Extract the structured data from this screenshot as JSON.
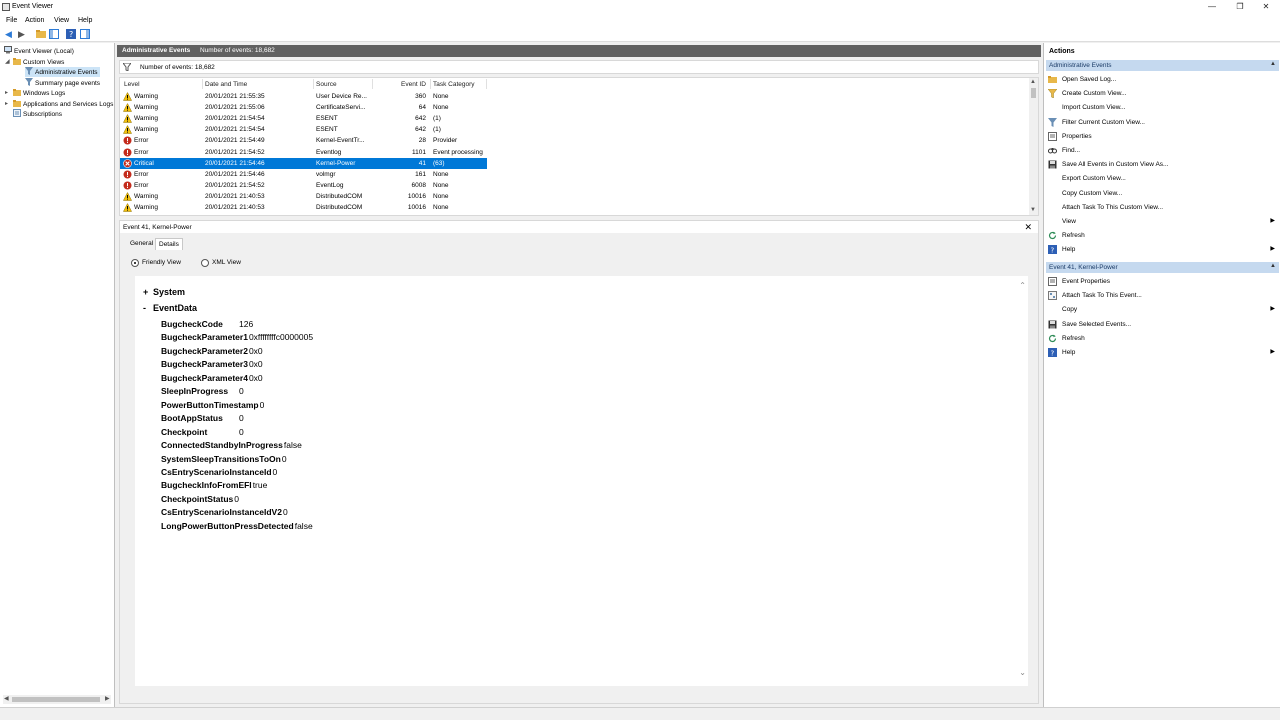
{
  "window": {
    "title": "Event Viewer",
    "controls": {
      "minimize": "—",
      "restore": "❐",
      "close": "✕"
    }
  },
  "menu": [
    "File",
    "Action",
    "View",
    "Help"
  ],
  "tree": {
    "items": [
      {
        "label": "Event Viewer (Local)"
      },
      {
        "label": "Custom Views"
      },
      {
        "label": "Administrative Events"
      },
      {
        "label": "Summary page events"
      },
      {
        "label": "Windows Logs"
      },
      {
        "label": "Applications and Services Logs"
      },
      {
        "label": "Subscriptions"
      }
    ]
  },
  "center": {
    "header_title": "Administrative Events",
    "header_count": "Number of events: 18,682",
    "filter_text": "Number of events: 18,682",
    "columns": [
      "Level",
      "Date and Time",
      "Source",
      "Event ID",
      "Task Category"
    ],
    "rows": [
      {
        "level": "Warning",
        "datetime": "20/01/2021 21:55:35",
        "source": "User Device Re...",
        "event_id": "360",
        "task": "None"
      },
      {
        "level": "Warning",
        "datetime": "20/01/2021 21:55:06",
        "source": "CertificateServi...",
        "event_id": "64",
        "task": "None"
      },
      {
        "level": "Warning",
        "datetime": "20/01/2021 21:54:54",
        "source": "ESENT",
        "event_id": "642",
        "task": "(1)"
      },
      {
        "level": "Warning",
        "datetime": "20/01/2021 21:54:54",
        "source": "ESENT",
        "event_id": "642",
        "task": "(1)"
      },
      {
        "level": "Error",
        "datetime": "20/01/2021 21:54:49",
        "source": "Kernel-EventTr...",
        "event_id": "28",
        "task": "Provider"
      },
      {
        "level": "Error",
        "datetime": "20/01/2021 21:54:52",
        "source": "Eventlog",
        "event_id": "1101",
        "task": "Event processing"
      },
      {
        "level": "Critical",
        "datetime": "20/01/2021 21:54:46",
        "source": "Kernel-Power",
        "event_id": "41",
        "task": "(63)"
      },
      {
        "level": "Error",
        "datetime": "20/01/2021 21:54:46",
        "source": "volmgr",
        "event_id": "161",
        "task": "None"
      },
      {
        "level": "Error",
        "datetime": "20/01/2021 21:54:52",
        "source": "EventLog",
        "event_id": "6008",
        "task": "None"
      },
      {
        "level": "Warning",
        "datetime": "20/01/2021 21:40:53",
        "source": "DistributedCOM",
        "event_id": "10016",
        "task": "None"
      },
      {
        "level": "Warning",
        "datetime": "20/01/2021 21:40:53",
        "source": "DistributedCOM",
        "event_id": "10016",
        "task": "None"
      }
    ],
    "selected_row": 6
  },
  "detail": {
    "title": "Event 41, Kernel-Power",
    "tabs": [
      "General",
      "Details"
    ],
    "radio_friendly": "Friendly View",
    "radio_xml": "XML View",
    "section_system": "System",
    "section_eventdata": "EventData",
    "system_toggle": "+",
    "eventdata_toggle": "-",
    "fields": [
      {
        "k": "BugcheckCode",
        "v": "126"
      },
      {
        "k": "BugcheckParameter1",
        "v": "0xffffffffc0000005"
      },
      {
        "k": "BugcheckParameter2",
        "v": "0x0"
      },
      {
        "k": "BugcheckParameter3",
        "v": "0x0"
      },
      {
        "k": "BugcheckParameter4",
        "v": "0x0"
      },
      {
        "k": "SleepInProgress",
        "v": "0"
      },
      {
        "k": "PowerButtonTimestamp",
        "v": "0"
      },
      {
        "k": "BootAppStatus",
        "v": "0"
      },
      {
        "k": "Checkpoint",
        "v": "0"
      },
      {
        "k": "ConnectedStandbyInProgress",
        "v": "false"
      },
      {
        "k": "SystemSleepTransitionsToOn",
        "v": "0"
      },
      {
        "k": "CsEntryScenarioInstanceId",
        "v": "0"
      },
      {
        "k": "BugcheckInfoFromEFI",
        "v": "true"
      },
      {
        "k": "CheckpointStatus",
        "v": "0"
      },
      {
        "k": "CsEntryScenarioInstanceIdV2",
        "v": "0"
      },
      {
        "k": "LongPowerButtonPressDetected",
        "v": "false"
      }
    ]
  },
  "actions": {
    "title": "Actions",
    "group1": "Administrative Events",
    "group1_items": [
      "Open Saved Log...",
      "Create Custom View...",
      "Import Custom View...",
      "Filter Current Custom View...",
      "Properties",
      "Find...",
      "Save All Events in Custom View As...",
      "Export Custom View...",
      "Copy Custom View...",
      "Attach Task To This Custom View...",
      "View",
      "Refresh",
      "Help"
    ],
    "group2": "Event 41, Kernel-Power",
    "group2_items": [
      "Event Properties",
      "Attach Task To This Event...",
      "Copy",
      "Save Selected Events...",
      "Refresh",
      "Help"
    ]
  },
  "colors": {
    "selection": "#0078d7",
    "header_bar": "#616161",
    "action_group": "#c5d9ef",
    "warning": "#f4c20d",
    "error": "#c42b1c"
  }
}
